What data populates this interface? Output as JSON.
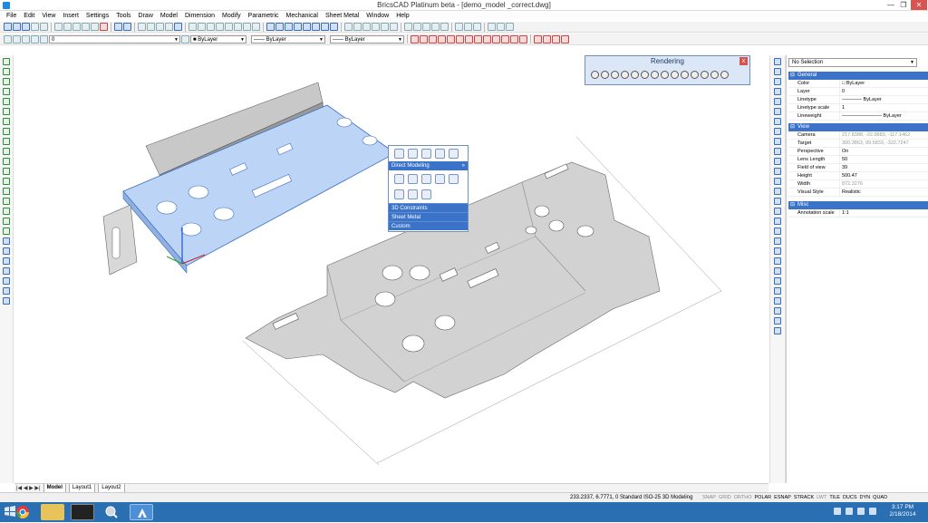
{
  "window": {
    "title": "BricsCAD Platinum beta - [demo_model _correct.dwg]",
    "minimize": "—",
    "maximize": "❐",
    "close": "✕"
  },
  "menu": [
    "File",
    "Edit",
    "View",
    "Insert",
    "Settings",
    "Tools",
    "Draw",
    "Model",
    "Dimension",
    "Modify",
    "Parametric",
    "Mechanical",
    "Sheet Metal",
    "Window",
    "Help"
  ],
  "toolbar": {
    "layer_value": "0",
    "color_value": "ByLayer",
    "linetype_value": "ByLayer",
    "lineweight_value": "ByLayer"
  },
  "rendering_toolbar": {
    "title": "Rendering",
    "close": "x"
  },
  "quad_menu": {
    "header": "Direct Modeling",
    "header_chevron": "»",
    "items": [
      "3D Constraints",
      "Sheet Metal",
      "Custom"
    ]
  },
  "properties": {
    "selection": "No Selection",
    "categories": {
      "general": "General",
      "view": "View",
      "misc": "Misc"
    },
    "general_rows": [
      {
        "key": "Color",
        "value": "ByLayer"
      },
      {
        "key": "Layer",
        "value": "0"
      },
      {
        "key": "Linetype",
        "value": "ByLayer"
      },
      {
        "key": "Linetype scale",
        "value": "1"
      },
      {
        "key": "Lineweight",
        "value": "ByLayer"
      }
    ],
    "view_rows": [
      {
        "key": "Camera",
        "value": "217.8388, -22.9883, -117.1462"
      },
      {
        "key": "Target",
        "value": "300.3863, 99.5833, -322.7247"
      },
      {
        "key": "Perspective",
        "value": "On"
      },
      {
        "key": "Lens Length",
        "value": "50"
      },
      {
        "key": "Field of view",
        "value": "39"
      },
      {
        "key": "Height",
        "value": "500.47"
      },
      {
        "key": "Width",
        "value": "872.3276"
      },
      {
        "key": "Visual Style",
        "value": "Realistic"
      }
    ],
    "misc_rows": [
      {
        "key": "Annotation scale",
        "value": "1:1"
      }
    ]
  },
  "layout_tabs": {
    "nav": "|◀ ◀ ▶ ▶|",
    "tabs": [
      "Model",
      "Layout1",
      "Layout2"
    ]
  },
  "status": {
    "coords": "233.2337, 6.7771, 0    Standard    ISO-25    3D Modeling",
    "toggles": [
      {
        "label": "SNAP",
        "on": false
      },
      {
        "label": "GRID",
        "on": false
      },
      {
        "label": "ORTHO",
        "on": false
      },
      {
        "label": "POLAR",
        "on": true
      },
      {
        "label": "ESNAP",
        "on": true
      },
      {
        "label": "STRACK",
        "on": true
      },
      {
        "label": "LWT",
        "on": false
      },
      {
        "label": "TILE",
        "on": true
      },
      {
        "label": "DUCS",
        "on": true
      },
      {
        "label": "DYN",
        "on": true
      },
      {
        "label": "QUAD",
        "on": true
      }
    ]
  },
  "taskbar": {
    "time": "3:17 PM",
    "date": "2/18/2014"
  },
  "colors": {
    "accent": "#3b73c9",
    "taskbar": "#2b6fb3",
    "selection": "#bcd4f5"
  }
}
